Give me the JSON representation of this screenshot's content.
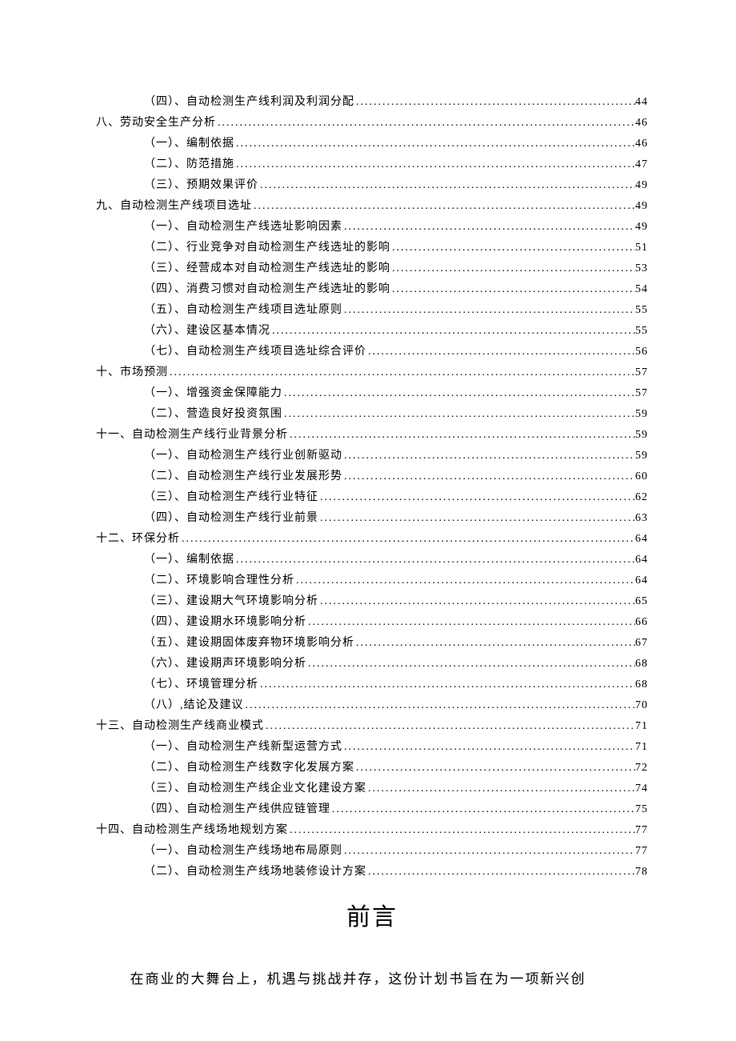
{
  "toc": [
    {
      "level": 2,
      "label": "（四）、自动检测生产线利润及利润分配",
      "page": "44"
    },
    {
      "level": 0,
      "label": "八、劳动安全生产分析",
      "page": "46"
    },
    {
      "level": 2,
      "label": "（一）、编制依据",
      "page": "46"
    },
    {
      "level": 2,
      "label": "（二）、防范措施",
      "page": "47"
    },
    {
      "level": 2,
      "label": "（三）、预期效果评价",
      "page": "49"
    },
    {
      "level": 0,
      "label": "九、自动检测生产线项目选址",
      "page": "49"
    },
    {
      "level": 2,
      "label": "（一）、自动检测生产线选址影响因素",
      "page": "49"
    },
    {
      "level": 2,
      "label": "（二）、行业竞争对自动检测生产线选址的影响",
      "page": "51"
    },
    {
      "level": 2,
      "label": "（三）、经营成本对自动检测生产线选址的影响",
      "page": "53"
    },
    {
      "level": 2,
      "label": "（四）、消费习惯对自动检测生产线选址的影响",
      "page": "54"
    },
    {
      "level": 2,
      "label": "（五）、自动检测生产线项目选址原则",
      "page": "55"
    },
    {
      "level": 2,
      "label": "（六）、建设区基本情况",
      "page": "55"
    },
    {
      "level": 2,
      "label": "（七）、自动检测生产线项目选址综合评价",
      "page": "56"
    },
    {
      "level": 0,
      "label": "十、市场预测",
      "page": "57"
    },
    {
      "level": 2,
      "label": "（一）、增强资金保障能力",
      "page": "57"
    },
    {
      "level": 2,
      "label": "（二）、营造良好投资氛围",
      "page": "59"
    },
    {
      "level": 0,
      "label": "十一、自动检测生产线行业背景分析",
      "page": "59"
    },
    {
      "level": 2,
      "label": "（一）、自动检测生产线行业创新驱动",
      "page": "59"
    },
    {
      "level": 2,
      "label": "（二）、自动检测生产线行业发展形势",
      "page": "60"
    },
    {
      "level": 2,
      "label": "（三）、自动检测生产线行业特征",
      "page": "62"
    },
    {
      "level": 2,
      "label": "（四）、自动检测生产线行业前景",
      "page": "63"
    },
    {
      "level": 0,
      "label": "十二、环保分析",
      "page": "64"
    },
    {
      "level": 2,
      "label": "（一）、编制依据",
      "page": "64"
    },
    {
      "level": 2,
      "label": "（二）、环境影响合理性分析",
      "page": "64"
    },
    {
      "level": 2,
      "label": "（三）、建设期大气环境影响分析",
      "page": "65"
    },
    {
      "level": 2,
      "label": "（四）、建设期水环境影响分析",
      "page": "66"
    },
    {
      "level": 2,
      "label": "（五）、建设期固体废弃物环境影响分析",
      "page": "67"
    },
    {
      "level": 2,
      "label": "（六）、建设期声环境影响分析",
      "page": "68"
    },
    {
      "level": 2,
      "label": "（七）、环境管理分析",
      "page": "68"
    },
    {
      "level": 2,
      "label": "（八）,结论及建议",
      "page": "70"
    },
    {
      "level": 0,
      "label": "十三、自动检测生产线商业模式",
      "page": "71"
    },
    {
      "level": 2,
      "label": "（一）、自动检测生产线新型运营方式",
      "page": "71"
    },
    {
      "level": 2,
      "label": "（二）、自动检测生产线数字化发展方案",
      "page": "72"
    },
    {
      "level": 2,
      "label": "（三）、自动检测生产线企业文化建设方案",
      "page": "74"
    },
    {
      "level": 2,
      "label": "（四）、自动检测生产线供应链管理",
      "page": "75"
    },
    {
      "level": 0,
      "label": "十四、自动检测生产线场地规划方案",
      "page": "77"
    },
    {
      "level": 2,
      "label": "（一）、自动检测生产线场地布局原则",
      "page": "77"
    },
    {
      "level": 2,
      "label": "（二）、自动检测生产线场地装修设计方案",
      "page": "78"
    }
  ],
  "heading": "前言",
  "paragraph": "在商业的大舞台上，机遇与挑战并存，这份计划书旨在为一项新兴创"
}
